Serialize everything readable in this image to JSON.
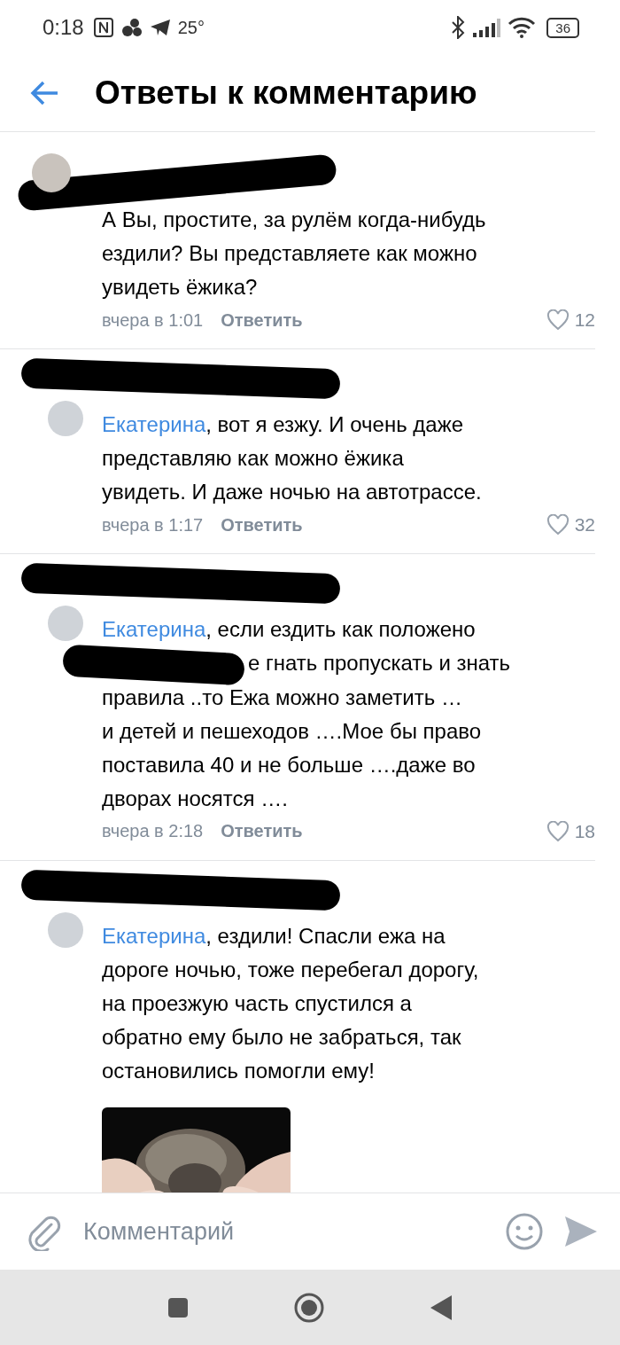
{
  "status_bar": {
    "time": "0:18",
    "temperature": "25°",
    "battery": "36"
  },
  "header": {
    "title": "Ответы к комментарию"
  },
  "comments": [
    {
      "lines": [
        {
          "text": "А Вы, простите, за рулём когда-нибудь",
          "covered": false
        },
        {
          "text": "ездили? Вы представляете как можно",
          "covered": false
        },
        {
          "text": "увидеть ёжика?",
          "covered": false
        }
      ],
      "time": "вчера в 1:01",
      "reply": "Ответить",
      "likes": "12"
    },
    {
      "mention": "Екатерина",
      "lines": [
        {
          "text": ", вот я езжу. И очень даже",
          "covered": false
        },
        {
          "text": "представляю как можно ёжика",
          "covered": false
        },
        {
          "text": "увидеть. И даже ночью на автотрассе.",
          "covered": false
        }
      ],
      "time": "вчера в 1:17",
      "reply": "Ответить",
      "likes": "32"
    },
    {
      "mention": "Екатерина",
      "lines": [
        {
          "text": ", если ездить как положено",
          "covered": false
        },
        {
          "text": "е гнать пропускать и знать",
          "covered": true
        },
        {
          "text": "правила ..то Ежа можно заметить …",
          "covered": false
        },
        {
          "text": "и детей и пешеходов ….Мое бы право",
          "covered": false
        },
        {
          "text": "поставила 40 и не больше ….даже во",
          "covered": false
        },
        {
          "text": "дворах носятся ….",
          "covered": false
        }
      ],
      "time": "вчера в 2:18",
      "reply": "Ответить",
      "likes": "18"
    },
    {
      "mention": "Екатерина",
      "lines": [
        {
          "text": ", ездили! Спасли ежа на",
          "covered": false
        },
        {
          "text": "дороге ночью, тоже перебегал дорогу,",
          "covered": false
        },
        {
          "text": "на проезжую часть спустился а",
          "covered": false
        },
        {
          "text": "обратно ему было не забраться, так",
          "covered": false
        },
        {
          "text": "остановились помогли ему!",
          "covered": false
        }
      ],
      "attachment": {
        "kind": "picture"
      }
    }
  ],
  "composer": {
    "placeholder": "Комментарий"
  }
}
